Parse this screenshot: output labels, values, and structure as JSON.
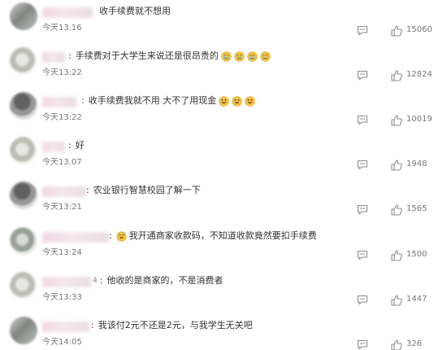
{
  "comments": [
    {
      "text": "收手续费就不想用",
      "time": "今天13.16",
      "likes": "15060",
      "emojis": []
    },
    {
      "text": "手续费对于大学生来说还是很昂贵的",
      "time": "今天13:22",
      "likes": "12824",
      "emojis": [
        "cry-emoji",
        "cry-emoji",
        "cry-emoji",
        "cry-emoji"
      ]
    },
    {
      "text": "收手续费我就不用 大不了用现金",
      "time": "今天13:22",
      "likes": "10019",
      "emojis": [
        "laugh-emoji",
        "laugh-emoji",
        "laugh-emoji"
      ]
    },
    {
      "text": "好",
      "time": "今天13.07",
      "likes": "1948",
      "emojis": []
    },
    {
      "text": "农业银行智慧校园了解一下",
      "time": "今天13:21",
      "likes": "1565",
      "emojis": []
    },
    {
      "text": "我开通商家收款码，不知道收款竟然要扣手续费",
      "time": "今天13:24",
      "likes": "1500",
      "emojis": [
        "sweat-laugh-emoji"
      ]
    },
    {
      "text": "他收的是商家的，不是消费者",
      "time": "今天13:33",
      "likes": "1447",
      "emojis": [],
      "name_suffix": "4"
    },
    {
      "text": "我该付2元不还是2元，与我学生无关吧",
      "time": "今天14:05",
      "likes": "326",
      "emojis": []
    }
  ],
  "colors": {
    "text": "#333333",
    "meta": "#777777",
    "blurred_name": "#f2d7e3",
    "icon": "#8c8c8c",
    "emoji_face": "#f5c542"
  }
}
